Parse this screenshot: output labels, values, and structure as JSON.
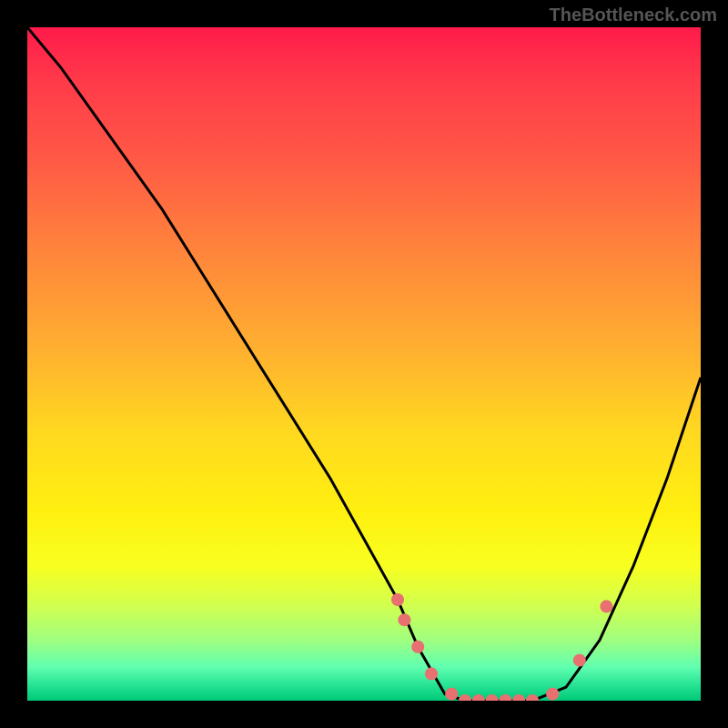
{
  "watermark": "TheBottleneck.com",
  "chart_data": {
    "type": "line",
    "title": "",
    "xlabel": "",
    "ylabel": "",
    "xlim": [
      0,
      100
    ],
    "ylim": [
      0,
      100
    ],
    "background_gradient": {
      "orientation": "vertical",
      "stops": [
        {
          "pos": 0,
          "color": "#ff1a4a"
        },
        {
          "pos": 50,
          "color": "#ffd020"
        },
        {
          "pos": 80,
          "color": "#f8ff20"
        },
        {
          "pos": 100,
          "color": "#00c878"
        }
      ]
    },
    "series": [
      {
        "name": "bottleneck-curve",
        "color": "#000000",
        "x": [
          0,
          5,
          10,
          15,
          20,
          25,
          30,
          35,
          40,
          45,
          50,
          55,
          58,
          62,
          65,
          70,
          75,
          80,
          85,
          90,
          95,
          100
        ],
        "y": [
          100,
          94,
          87,
          80,
          73,
          65,
          57,
          49,
          41,
          33,
          24,
          15,
          8,
          1,
          0,
          0,
          0,
          2,
          9,
          20,
          33,
          48
        ]
      }
    ],
    "markers": {
      "name": "highlight-points",
      "color": "#e87070",
      "points": [
        {
          "x": 55,
          "y": 15
        },
        {
          "x": 56,
          "y": 12
        },
        {
          "x": 58,
          "y": 8
        },
        {
          "x": 60,
          "y": 4
        },
        {
          "x": 63,
          "y": 1
        },
        {
          "x": 65,
          "y": 0
        },
        {
          "x": 67,
          "y": 0
        },
        {
          "x": 69,
          "y": 0
        },
        {
          "x": 71,
          "y": 0
        },
        {
          "x": 73,
          "y": 0
        },
        {
          "x": 75,
          "y": 0
        },
        {
          "x": 78,
          "y": 1
        },
        {
          "x": 82,
          "y": 6
        },
        {
          "x": 86,
          "y": 14
        }
      ]
    }
  }
}
